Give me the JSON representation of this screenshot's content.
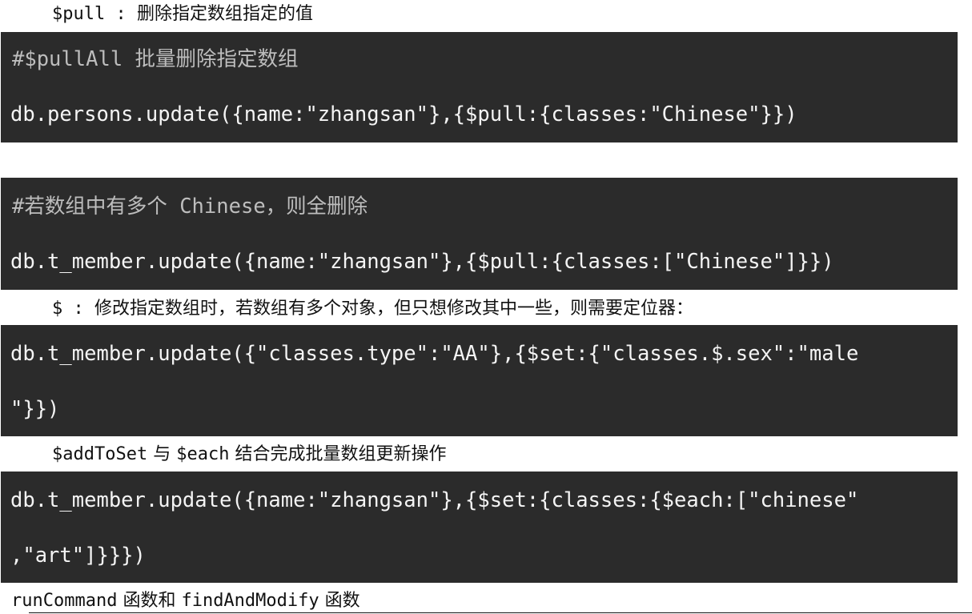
{
  "note_pull": {
    "code": "$pull",
    "sep": " : ",
    "text": "删除指定数组指定的值"
  },
  "block1": {
    "comment": "#$pullAll 批量删除指定数组",
    "code": "db.persons.update({name:\"zhangsan\"},{$pull:{classes:\"Chinese\"}})"
  },
  "block2": {
    "comment": "#若数组中有多个 Chinese，则全删除",
    "code": "db.t_member.update({name:\"zhangsan\"},{$pull:{classes:[\"Chinese\"]}})"
  },
  "note_positional": {
    "code": "$",
    "sep": " : ",
    "text": "修改指定数组时，若数组有多个对象，但只想修改其中一些，则需要定位器："
  },
  "block3": {
    "line1": "db.t_member.update({\"classes.type\":\"AA\"},{$set:{\"classes.$.sex\":\"male",
    "line2": "\"}})"
  },
  "note_addtoset": {
    "code1": "$addToSet",
    "mid": " 与 ",
    "code2": "$each",
    "text": " 结合完成批量数组更新操作"
  },
  "block4": {
    "line1": "db.t_member.update({name:\"zhangsan\"},{$set:{classes:{$each:[\"chinese\"",
    "line2": ",\"art\"]}}})"
  },
  "heading": {
    "code1": "runCommand",
    "mid": " 函数和 ",
    "code2": "findAndModify",
    "text": " 函数"
  }
}
